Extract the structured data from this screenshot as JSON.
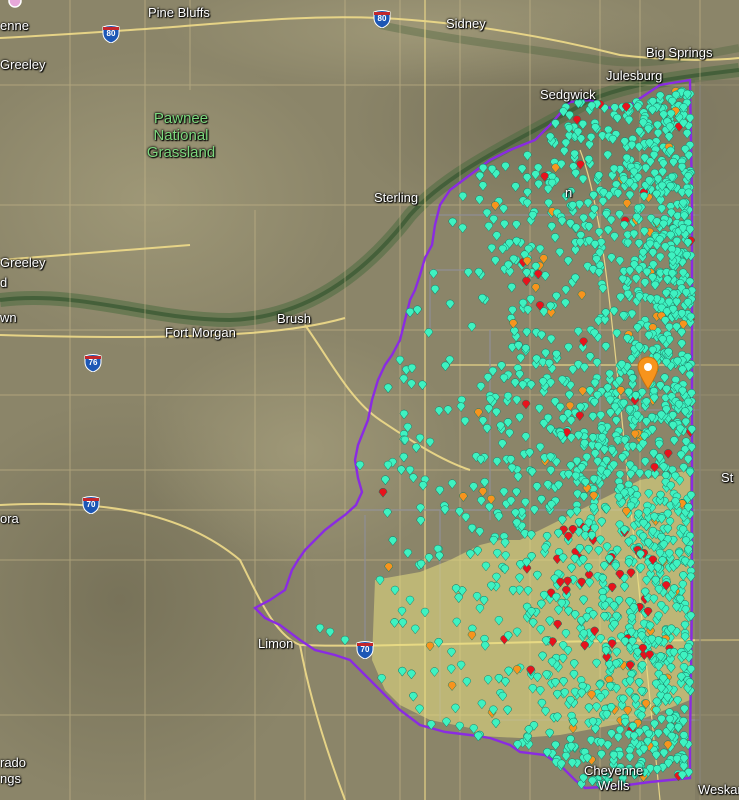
{
  "map": {
    "towns": [
      {
        "key": "pine-bluffs",
        "name": "Pine Bluffs"
      },
      {
        "key": "sidney",
        "name": "Sidney"
      },
      {
        "key": "big-springs",
        "name": "Big Springs"
      },
      {
        "key": "julesburg",
        "name": "Julesburg"
      },
      {
        "key": "sedgwick",
        "name": "Sedgwick"
      },
      {
        "key": "sterling",
        "name": "Sterling"
      },
      {
        "key": "brush",
        "name": "Brush"
      },
      {
        "key": "fort-morgan",
        "name": "Fort Morgan"
      },
      {
        "key": "limon",
        "name": "Limon"
      },
      {
        "key": "greeley-top",
        "name": "Greeley"
      },
      {
        "key": "greeley-left",
        "name": "Greeley"
      },
      {
        "key": "cheyenne-top",
        "name": "enne"
      },
      {
        "key": "cheyenne-wells-1",
        "name": "Cheyenne"
      },
      {
        "key": "cheyenne-wells-2",
        "name": "Wells"
      },
      {
        "key": "colorado-springs-1",
        "name": "rado"
      },
      {
        "key": "colorado-springs-2",
        "name": "ngs"
      },
      {
        "key": "weskan",
        "name": "Weskan"
      },
      {
        "key": "st-francis",
        "name": "St"
      },
      {
        "key": "aurora",
        "name": "ora"
      },
      {
        "key": "d-label",
        "name": "d"
      },
      {
        "key": "wn-label",
        "name": "wn"
      },
      {
        "key": "n-label",
        "name": "n"
      }
    ],
    "park": {
      "line1": "Pawnee",
      "line2": "National",
      "line3": "Grassland"
    },
    "highways": [
      {
        "key": "i80-west",
        "number": "80"
      },
      {
        "key": "i80-east",
        "number": "80"
      },
      {
        "key": "i76",
        "number": "76"
      },
      {
        "key": "i70-west",
        "number": "70"
      },
      {
        "key": "i70-east",
        "number": "70"
      }
    ],
    "colors": {
      "well_marker": "#3ef2c1",
      "alert_marker": "#f7941d",
      "red_marker": "#e8121c",
      "boundary": "#8a2be2",
      "yellow_region": "#e8df82",
      "location_pin": "#f7941d"
    },
    "icons": [
      "location-pin-icon",
      "interstate-shield-icon",
      "well-marker-icon"
    ]
  }
}
